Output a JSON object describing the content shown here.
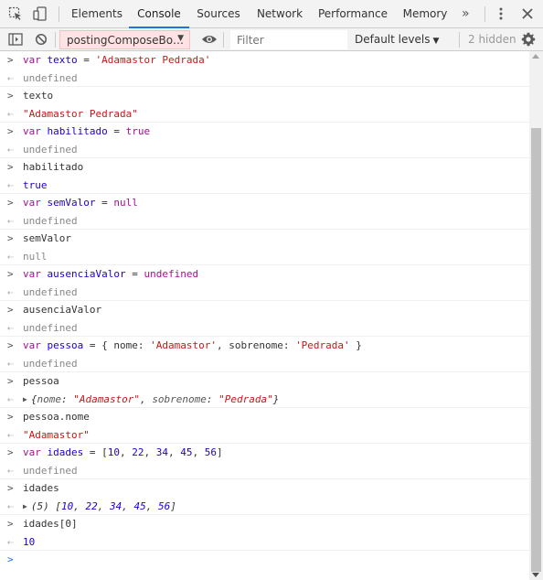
{
  "tabs": {
    "items": [
      "Elements",
      "Console",
      "Sources",
      "Network",
      "Performance",
      "Memory"
    ],
    "active": "Console",
    "more": "»"
  },
  "icons": {
    "inspect": "inspect-element-icon",
    "device": "device-toolbar-icon",
    "menu": "vertical-ellipsis-icon",
    "close": "close-icon",
    "sidebar": "console-sidebar-icon",
    "clear": "clear-console-icon",
    "eye": "live-expression-eye-icon",
    "settings": "gear-icon"
  },
  "toolbar": {
    "context": "postingComposeBo…",
    "filter_placeholder": "Filter",
    "levels": "Default levels",
    "hidden": "2 hidden"
  },
  "console": {
    "lines": [
      {
        "type": "input",
        "text": "var texto = 'Adamastor Pedrada'"
      },
      {
        "type": "result",
        "text": "undefined"
      },
      {
        "type": "input",
        "text": "texto"
      },
      {
        "type": "result",
        "text": "\"Adamastor Pedrada\""
      },
      {
        "type": "input",
        "text": "var habilitado = true"
      },
      {
        "type": "result",
        "text": "undefined"
      },
      {
        "type": "input",
        "text": "habilitado"
      },
      {
        "type": "result",
        "text": "true"
      },
      {
        "type": "input",
        "text": "var semValor = null"
      },
      {
        "type": "result",
        "text": "undefined"
      },
      {
        "type": "input",
        "text": "semValor"
      },
      {
        "type": "result",
        "text": "null"
      },
      {
        "type": "input",
        "text": "var ausenciaValor = undefined"
      },
      {
        "type": "result",
        "text": "undefined"
      },
      {
        "type": "input",
        "text": "ausenciaValor"
      },
      {
        "type": "result",
        "text": "undefined"
      },
      {
        "type": "input",
        "text": "var pessoa = { nome: 'Adamastor', sobrenome: 'Pedrada' }"
      },
      {
        "type": "result",
        "text": "undefined"
      },
      {
        "type": "input",
        "text": "pessoa"
      },
      {
        "type": "result",
        "text": "{nome: \"Adamastor\", sobrenome: \"Pedrada\"}"
      },
      {
        "type": "input",
        "text": "pessoa.nome"
      },
      {
        "type": "result",
        "text": "\"Adamastor\""
      },
      {
        "type": "input",
        "text": "var idades = [10, 22, 34, 45, 56]"
      },
      {
        "type": "result",
        "text": "undefined"
      },
      {
        "type": "input",
        "text": "idades"
      },
      {
        "type": "result",
        "text": "(5) [10, 22, 34, 45, 56]"
      },
      {
        "type": "input",
        "text": "idades[0]"
      },
      {
        "type": "result",
        "text": "10"
      }
    ],
    "prompt": ""
  },
  "colors": {
    "accent": "#1a73e8",
    "keyword": "#aa0d91",
    "variable": "#1c00cf",
    "string": "#c41a16",
    "context_bg": "#fde3e3"
  }
}
